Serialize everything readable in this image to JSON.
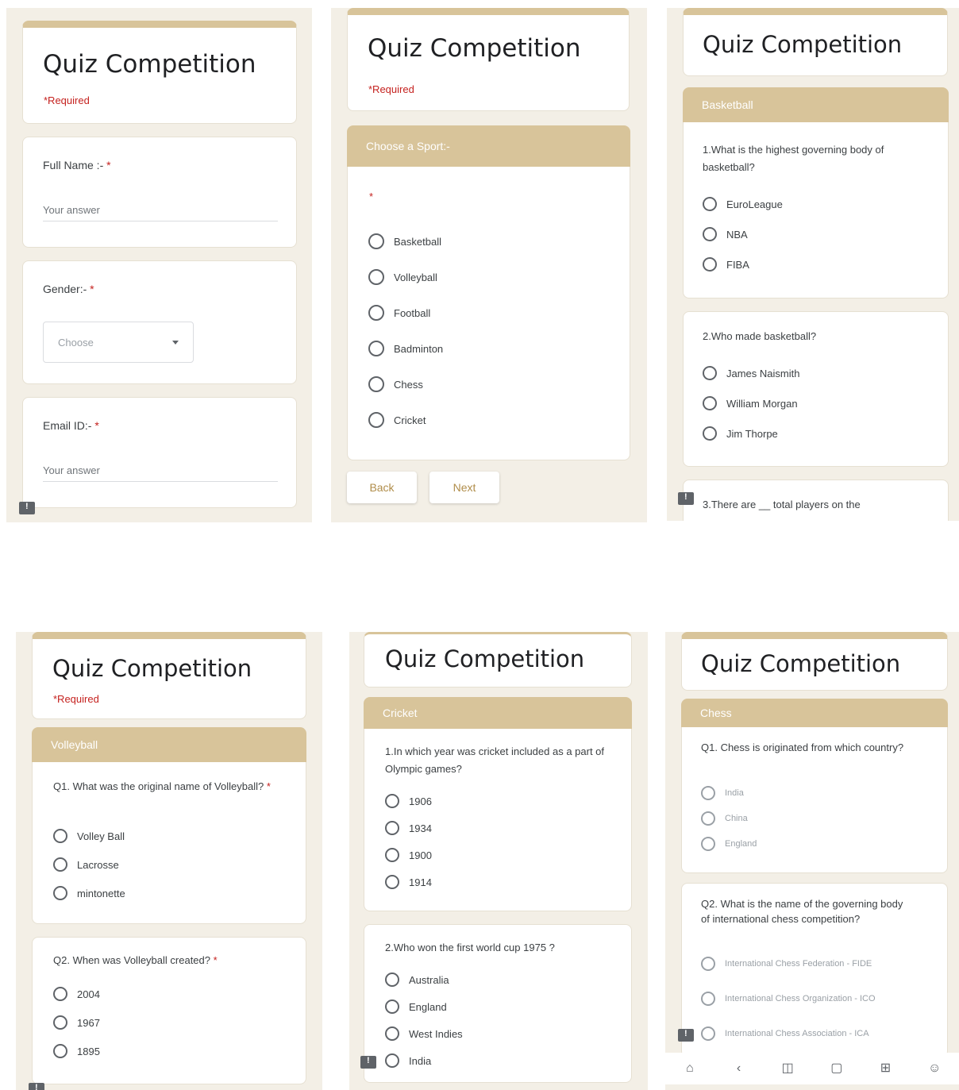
{
  "form_title": "Quiz Competition",
  "required_note": "*Required",
  "required_star": "*",
  "accent_color": "#d8c49a",
  "screen1": {
    "full_name_label": "Full Name :- ",
    "full_name_placeholder": "Your answer",
    "gender_label": "Gender:- ",
    "gender_select": "Choose",
    "email_label": "Email ID:- ",
    "email_placeholder": "Your answer"
  },
  "screen2": {
    "section_title": "Choose a Sport:-",
    "options": [
      "Basketball",
      "Volleyball",
      "Football",
      "Badminton",
      "Chess",
      "Cricket"
    ],
    "back_button": "Back",
    "next_button": "Next"
  },
  "screen3": {
    "section_title": "Basketball",
    "q1": "1.What is the highest governing body of basketball?",
    "q1_options": [
      "EuroLeague",
      "NBA",
      "FIBA"
    ],
    "q2": "2.Who made basketball?",
    "q2_options": [
      "James Naismith",
      "William Morgan",
      "Jim Thorpe"
    ],
    "q3": "3.There are __ total players on the"
  },
  "screen4": {
    "section_title": "Volleyball",
    "q1": "Q1. What was the original name of Volleyball? ",
    "q1_options": [
      "Volley Ball",
      "Lacrosse",
      "mintonette"
    ],
    "q2": "Q2. When was Volleyball created? ",
    "q2_options": [
      "2004",
      "1967",
      "1895"
    ]
  },
  "screen5": {
    "section_title": "Cricket",
    "q1": "1.In which year was cricket included as a part of Olympic games?",
    "q1_options": [
      "1906",
      "1934",
      "1900",
      "1914"
    ],
    "q2": "2.Who won the first world cup 1975 ?",
    "q2_options": [
      "Australia",
      "England",
      "West Indies",
      "India"
    ]
  },
  "screen6": {
    "section_title": "Chess",
    "q1": "Q1. Chess is originated from which country?",
    "q1_options": [
      "India",
      "China",
      "England"
    ],
    "q2": "Q2. What is the name of the governing body of international chess competition?",
    "q2_options": [
      "International Chess Federation - FIDE",
      "International Chess Organization - ICO",
      "International Chess Association - ICA"
    ]
  },
  "icons": {
    "feedback": "feedback-icon",
    "nav": [
      "home-icon",
      "back-icon",
      "book-icon",
      "tabs-icon",
      "add-tab-icon",
      "profile-icon"
    ]
  }
}
